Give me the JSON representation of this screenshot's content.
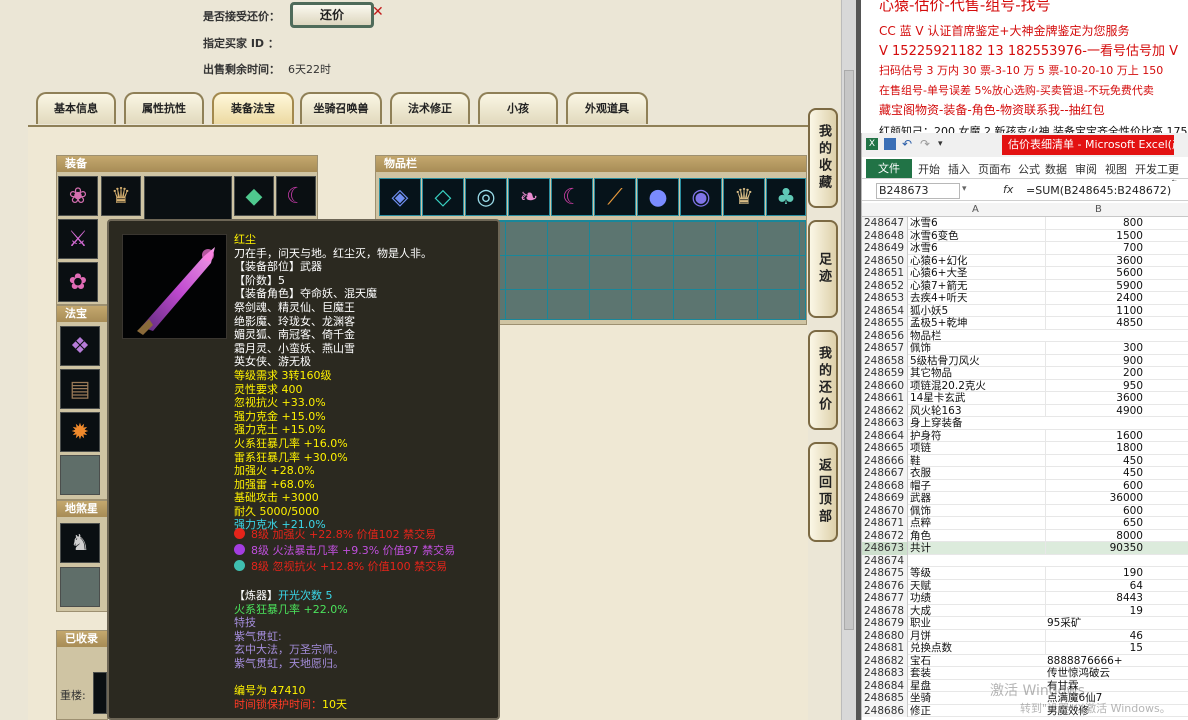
{
  "trade": {
    "accept_counter_label": "是否接受还价：",
    "counter_button": "还价",
    "buyer_label": "指定买家 ID ：",
    "time_label": "出售剩余时间：",
    "time_value": "6天22时"
  },
  "tabs": [
    "基本信息",
    "属性抗性",
    "装备法宝",
    "坐骑召唤兽",
    "法术修正",
    "小孩",
    "外观道具"
  ],
  "active_tab": "装备法宝",
  "sections": {
    "equipment": "装备",
    "treasure": "法宝",
    "earth": "地煞星阵",
    "inventory": "物品栏",
    "collected": "已收录的"
  },
  "bottom_left_label": "重楼:",
  "side_buttons": [
    "我的收藏",
    "足迹",
    "我的还价",
    "返回顶部"
  ],
  "tooltip": {
    "name": "红尘",
    "desc": "刀在手，问天与地。红尘灭，物是人非。",
    "lines": [
      {
        "text": "【装备部位】武器",
        "color": "c-white"
      },
      {
        "text": "【阶数】5",
        "color": "c-white"
      },
      {
        "text": "【装备角色】夺命妖、混天魔",
        "color": "c-white"
      },
      {
        "text": "祭剑魂、精灵仙、巨魔王",
        "color": "c-white"
      },
      {
        "text": "绝影魔、玲珑女、龙渊客",
        "color": "c-white"
      },
      {
        "text": "媚灵狐、南冠客、倚千金",
        "color": "c-white"
      },
      {
        "text": "霜月灵、小蛮妖、燕山雪",
        "color": "c-white"
      },
      {
        "text": "英女侠、游无极",
        "color": "c-white"
      },
      {
        "text": "等级需求 3转160级",
        "color": "c-yellow"
      },
      {
        "text": "灵性要求 400",
        "color": "c-yellow"
      },
      {
        "text": "忽视抗火 +33.0%",
        "color": "c-yellow"
      },
      {
        "text": "强力克金 +15.0%",
        "color": "c-yellow"
      },
      {
        "text": "强力克土 +15.0%",
        "color": "c-yellow"
      },
      {
        "text": "火系狂暴几率 +16.0%",
        "color": "c-yellow"
      },
      {
        "text": "雷系狂暴几率 +30.0%",
        "color": "c-yellow"
      },
      {
        "text": "加强火 +28.0%",
        "color": "c-yellow"
      },
      {
        "text": "加强雷 +68.0%",
        "color": "c-yellow"
      },
      {
        "text": "基础攻击 +3000",
        "color": "c-yellow"
      },
      {
        "text": "耐久 5000/5000",
        "color": "c-yellow"
      },
      {
        "text": "强力克水 +21.0%",
        "color": "c-cyan"
      }
    ],
    "gems": [
      {
        "text": "8级 加强火 +22.8% 价值102 禁交易",
        "color": "#e5241a"
      },
      {
        "text": "8级 火法暴击几率 +9.3% 价值97 禁交易",
        "color": "#a43de0"
      },
      {
        "text": "8级 忽视抗火 +12.8% 价值100 禁交易",
        "color": "#3fbfb0"
      }
    ],
    "refine_label": "【炼器】",
    "refine_value": "开光次数 5",
    "refine_stat": "火系狂暴几率 +22.0%",
    "skill_label": "特技",
    "skill_name": "紫气贯虹:",
    "skill_desc1": "玄中大法，万圣宗师。",
    "skill_desc2": "紫气贯虹，天地愿归。",
    "serial": "编号为 47410",
    "protect_label": "时间锁保护时间：",
    "protect_value": "10天"
  },
  "doc": {
    "lines": [
      {
        "text": "心猿-估价-代售-组号-找号",
        "color": "#d40c0c",
        "size": 15
      },
      {
        "text": "CC 蓝 V 认证首席鉴定+大神金牌鉴定为您服务",
        "color": "#d40c0c",
        "size": 12
      },
      {
        "text": "V 15225921182      13 182553976-一看号估号加 V",
        "color": "#d40c0c",
        "size": 13
      },
      {
        "text": "扫码估号 3 万内 30 票-3-10 万 5 票-10-20-10 万上 150",
        "color": "#d40c0c",
        "size": 11
      },
      {
        "text": "在售组号-单号误差 5%放心选购-买卖管退-不玩免费代卖",
        "color": "#d40c0c",
        "size": 11
      },
      {
        "text": "藏宝阁物资-装备-角色-物资联系我--抽红包",
        "color": "#d40c0c",
        "size": 12
      },
      {
        "text": "红颜知己：200 女魔 2 新孩克火神 装备宝宝齐全性价比高 175",
        "color": "#111",
        "size": 11
      }
    ]
  },
  "excel": {
    "title": "估价表细清单 - Microsoft Excel(产品...",
    "ribbon_tabs": [
      "文件",
      "开始",
      "插入",
      "页面布",
      "公式",
      "数据",
      "审阅",
      "视图",
      "开发工",
      "更多"
    ],
    "name_box": "B248673",
    "formula": "=SUM(B248645:B248672)",
    "col_a": "A",
    "col_b": "B",
    "rows": [
      [
        "248647",
        "冰雪6",
        "800"
      ],
      [
        "248648",
        "冰雪6变色",
        "1500"
      ],
      [
        "248649",
        "冰雪6",
        "700"
      ],
      [
        "248650",
        "心猿6+幻化",
        "3600"
      ],
      [
        "248651",
        "心猿6+大圣",
        "5600"
      ],
      [
        "248652",
        "心猿7+箭无",
        "5900"
      ],
      [
        "248653",
        "去疾4+听天",
        "2400"
      ],
      [
        "248654",
        "狐小妖5",
        "1100"
      ],
      [
        "248655",
        "孟极5+乾坤",
        "4850"
      ],
      [
        "248656",
        "物品栏",
        ""
      ],
      [
        "248657",
        "佩饰",
        "300"
      ],
      [
        "248658",
        "5级枯骨刀风火",
        "900"
      ],
      [
        "248659",
        "其它物品",
        "200"
      ],
      [
        "248660",
        "项链混20.2克火",
        "950"
      ],
      [
        "248661",
        "14星卡玄武",
        "3600"
      ],
      [
        "248662",
        "风火轮163",
        "4900"
      ],
      [
        "248663",
        "身上穿装备",
        ""
      ],
      [
        "248664",
        "护身符",
        "1600"
      ],
      [
        "248665",
        "项链",
        "1800"
      ],
      [
        "248666",
        "鞋",
        "450"
      ],
      [
        "248667",
        "衣服",
        "450"
      ],
      [
        "248668",
        "帽子",
        "600"
      ],
      [
        "248669",
        "武器",
        "36000"
      ],
      [
        "248670",
        "佩饰",
        "600"
      ],
      [
        "248671",
        "点粹",
        "650"
      ],
      [
        "248672",
        "角色",
        "8000"
      ],
      [
        "248673",
        "共计",
        "90350"
      ],
      [
        "248674",
        "",
        ""
      ],
      [
        "248675",
        "等级",
        "190"
      ],
      [
        "248676",
        "天赋",
        "64"
      ],
      [
        "248677",
        "功绩",
        "8443"
      ],
      [
        "248678",
        "大成",
        "19"
      ],
      [
        "248679",
        "职业",
        "95采矿"
      ],
      [
        "248680",
        "月饼",
        "46"
      ],
      [
        "248681",
        "兑换点数",
        "15"
      ],
      [
        "248682",
        "宝石",
        "8888876666+"
      ],
      [
        "248683",
        "套装",
        "传世惊鸿破云"
      ],
      [
        "248684",
        "星盘",
        "有甘霖"
      ],
      [
        "248685",
        "坐骑",
        "点满魔6仙7"
      ],
      [
        "248686",
        "修正",
        "男魔效修"
      ]
    ],
    "left_align_from": "248679",
    "watermark1": "激活 Windows",
    "watermark2": "转到\"设置\"以激活 Windows。"
  }
}
